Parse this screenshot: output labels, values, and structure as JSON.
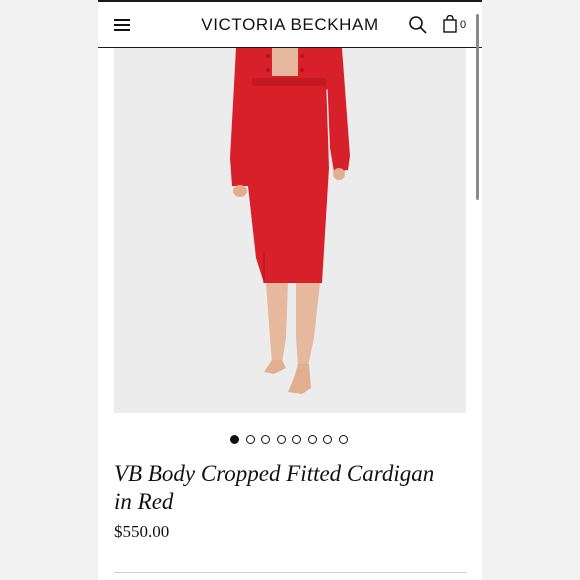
{
  "header": {
    "brand": "VICTORIA BECKHAM",
    "bag_count": "0",
    "icons": [
      "menu-icon",
      "search-icon",
      "bag-icon"
    ]
  },
  "gallery": {
    "image_count": 8,
    "active_index": 0
  },
  "product": {
    "title_line1": "VB Body Cropped Fitted Cardigan",
    "title_line2": "in Red",
    "price": "$550.00"
  },
  "colors": {
    "garment_red": "#d8202a",
    "background": "#ececec",
    "text": "#111111"
  }
}
